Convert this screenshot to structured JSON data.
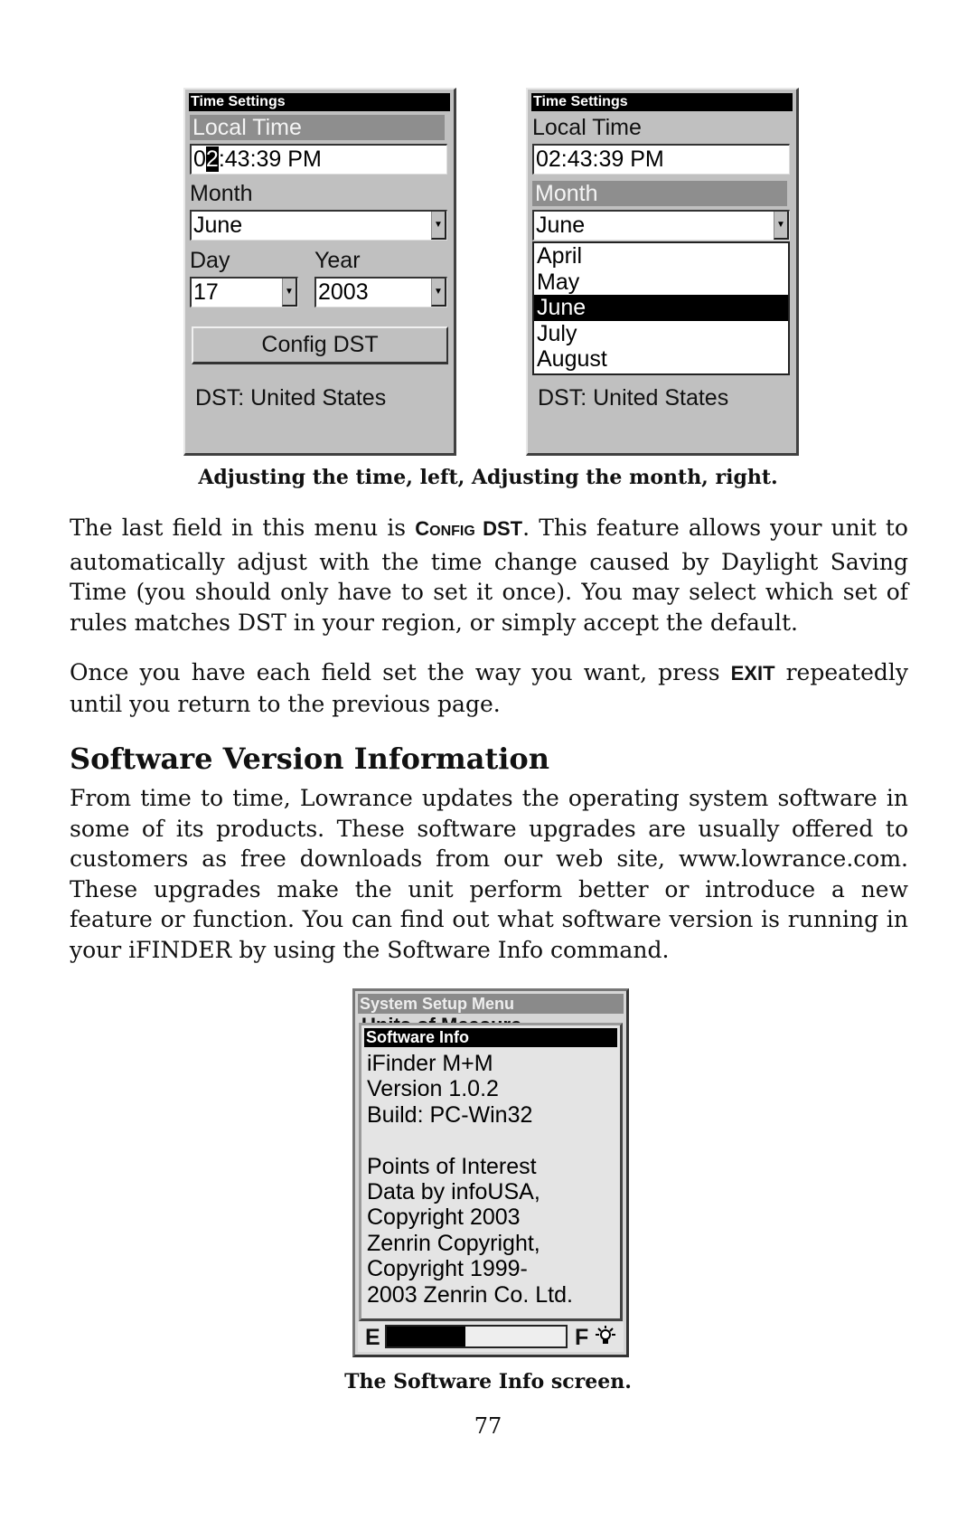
{
  "figure1": {
    "left_panel": {
      "title": "Time Settings",
      "local_time_label": "Local Time",
      "time_value_prefix": "0",
      "time_value_cursor": "2",
      "time_value_suffix": ":43:39  PM",
      "month_label": "Month",
      "month_value": "June",
      "day_label": "Day",
      "day_value": "17",
      "year_label": "Year",
      "year_value": "2003",
      "config_button": "Config DST",
      "dst_status": "DST: United States",
      "highlighted_field": "Local Time"
    },
    "right_panel": {
      "title": "Time Settings",
      "local_time_label": "Local Time",
      "time_value": "02:43:39  PM",
      "month_label": "Month",
      "month_value": "June",
      "month_options": [
        "April",
        "May",
        "June",
        "July",
        "August"
      ],
      "selected_option": "June",
      "dst_status": "DST: United States",
      "highlighted_field": "Month"
    },
    "caption": "Adjusting the time, left, Adjusting the month, right."
  },
  "body": {
    "para1_before": "The last field in this menu is ",
    "para1_sc_big": "C",
    "para1_sc_small": "ONFIG",
    "para1_sc_rest": " DST",
    "para1_after": ". This feature allows your unit to automatically adjust with the time change caused by Daylight Saving Time (you should only have to set it once). You may select which set of rules matches DST in your region, or simply accept the default.",
    "para2_before": "Once you have each field set the way you want, press ",
    "para2_key": "EXIT",
    "para2_after": " repeatedly until you return to the previous page.",
    "heading": "Software Version Information",
    "para3": "From time to time, Lowrance updates the operating system software in some of its products. These software upgrades are usually offered to customers as free downloads from our web site, www.lowrance.com. These upgrades make the unit perform better or introduce a new feature or function. You can find out what software version is running in your iFINDER by using the Software Info command."
  },
  "figure2": {
    "menu_title": "System Setup Menu",
    "menu_item_partial": "Units of Measure",
    "dialog_title": "Software Info",
    "lines": "iFinder M+M\nVersion 1.0.2\nBuild: PC-Win32\n\nPoints of Interest\nData by infoUSA,\nCopyright 2003\nZenrin Copyright,\nCopyright 1999-\n2003 Zenrin Co. Ltd.",
    "gauge_empty_label": "E",
    "gauge_full_label": "F",
    "gauge_level": 0.44,
    "backlight_icon": "lightbulb-icon",
    "caption": "The Software Info screen."
  },
  "page_number": "77"
}
